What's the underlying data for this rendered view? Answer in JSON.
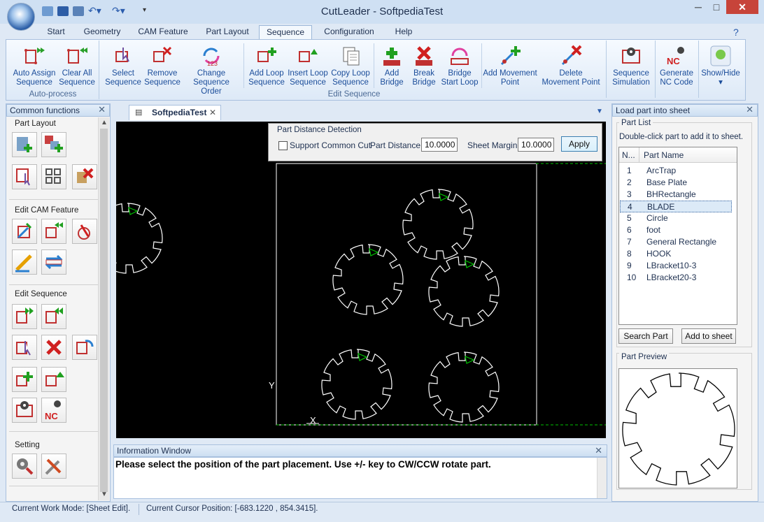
{
  "window": {
    "title": "CutLeader - SoftpediaTest",
    "minimize": "─",
    "maximize": "□",
    "close": "✕"
  },
  "ribbon_tabs": [
    "Start",
    "Geometry",
    "CAM Feature",
    "Part Layout",
    "Sequence",
    "Configuration",
    "Help"
  ],
  "active_tab": "Sequence",
  "groups": {
    "auto_process": {
      "label": "Auto-process",
      "buttons": [
        "Auto Assign\nSequence",
        "Clear All\nSequence"
      ]
    },
    "edit_sequence": {
      "label": "Edit Sequence",
      "buttons": [
        "Select\nSequence",
        "Remove\nSequence",
        "Change\nSequence Order",
        "Add Loop\nSequence",
        "Insert Loop\nSequence",
        "Copy Loop\nSequence",
        "Add\nBridge",
        "Break\nBridge",
        "Bridge\nStart Loop",
        "Add Movement\nPoint",
        "Delete\nMovement Point"
      ]
    },
    "extra": {
      "buttons": [
        "Sequence\nSimulation",
        "Generate\nNC Code",
        "Show/Hide"
      ]
    }
  },
  "left_panel": {
    "title": "Common functions",
    "sections": [
      "Part Layout",
      "Edit CAM Feature",
      "Edit Sequence",
      "Setting"
    ]
  },
  "document": {
    "tab_label": "SoftpediaTest"
  },
  "part_distance": {
    "title": "Part Distance Detection",
    "common_cut_label": "Support Common Cut",
    "common_cut_checked": false,
    "part_distance_label": "Part Distance:",
    "part_distance_value": "10.0000",
    "sheet_margin_label": "Sheet Margin:",
    "sheet_margin_value": "10.0000",
    "apply_label": "Apply"
  },
  "canvas": {
    "axis_y": "Y",
    "axis_x": "X"
  },
  "info_window": {
    "title": "Information Window",
    "message": "Please select the position of the part placement. Use +/- key to CW/CCW rotate part."
  },
  "right_panel": {
    "title": "Load part into sheet",
    "part_list_label": "Part List",
    "hint": "Double-click part to add it to sheet.",
    "columns": [
      "N...",
      "Part Name"
    ],
    "parts": [
      {
        "n": "1",
        "name": "ArcTrap"
      },
      {
        "n": "2",
        "name": "Base Plate"
      },
      {
        "n": "3",
        "name": "BHRectangle"
      },
      {
        "n": "4",
        "name": "BLADE"
      },
      {
        "n": "5",
        "name": "Circle"
      },
      {
        "n": "6",
        "name": "foot"
      },
      {
        "n": "7",
        "name": "General Rectangle"
      },
      {
        "n": "8",
        "name": "HOOK"
      },
      {
        "n": "9",
        "name": "LBracket10-3"
      },
      {
        "n": "10",
        "name": "LBracket20-3"
      }
    ],
    "selected_part": "BLADE",
    "search_button": "Search Part",
    "add_button": "Add to sheet",
    "preview_label": "Part Preview"
  },
  "status": {
    "work_mode": "Current Work Mode: [Sheet Edit].",
    "cursor": "Current Cursor Position: [-683.1220 , 854.3415]."
  },
  "colors": {
    "accent": "#1b4d9a",
    "canvas_bg": "#000000",
    "part_outline": "#ffffff",
    "marker": "#00c000",
    "close": "#c7443a"
  }
}
